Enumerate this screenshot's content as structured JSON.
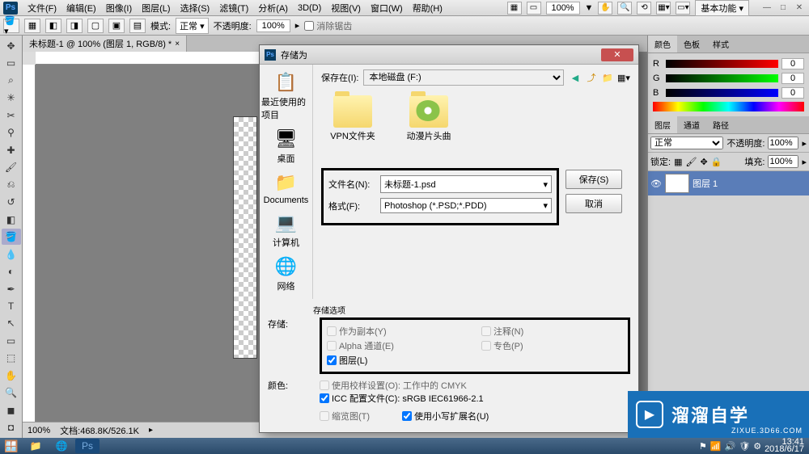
{
  "menubar": {
    "items": [
      "文件(F)",
      "编辑(E)",
      "图像(I)",
      "图层(L)",
      "选择(S)",
      "滤镜(T)",
      "分析(A)",
      "3D(D)",
      "视图(V)",
      "窗口(W)",
      "帮助(H)"
    ],
    "zoom": "100%",
    "workspace": "基本功能"
  },
  "optionsbar": {
    "mode_label": "模式:",
    "mode_value": "正常",
    "opacity_label": "不透明度:",
    "opacity_value": "100%",
    "antialias": "消除锯齿"
  },
  "document": {
    "tab": "未标题-1 @ 100% (图层 1, RGB/8) *",
    "zoom_status": "100%",
    "size_status": "文档:468.8K/526.1K"
  },
  "panels": {
    "color_tabs": [
      "颜色",
      "色板",
      "样式"
    ],
    "rgb": {
      "r": "0",
      "g": "0",
      "b": "0"
    },
    "layer_tabs": [
      "图层",
      "通道",
      "路径"
    ],
    "blend_mode": "正常",
    "opacity_label": "不透明度:",
    "opacity_value": "100%",
    "lock_label": "锁定:",
    "fill_label": "填充:",
    "fill_value": "100%",
    "layer_name": "图层 1"
  },
  "dialog": {
    "title": "存储为",
    "save_in_label": "保存在(I):",
    "save_in_value": "本地磁盘 (F:)",
    "places": [
      "最近使用的项目",
      "桌面",
      "Documents",
      "计算机",
      "网络"
    ],
    "files": [
      "VPN文件夹",
      "动漫片头曲"
    ],
    "filename_label": "文件名(N):",
    "filename_value": "未标题-1.psd",
    "format_label": "格式(F):",
    "format_value": "Photoshop (*.PSD;*.PDD)",
    "save_btn": "保存(S)",
    "cancel_btn": "取消",
    "storage_header": "存储选项",
    "storage_label": "存储:",
    "opt_copy": "作为副本(Y)",
    "opt_notes": "注释(N)",
    "opt_alpha": "Alpha 通道(E)",
    "opt_spot": "专色(P)",
    "opt_layers": "图层(L)",
    "color_label": "颜色:",
    "opt_proof": "使用校样设置(O): 工作中的 CMYK",
    "opt_icc": "ICC 配置文件(C): sRGB IEC61966-2.1",
    "opt_thumb": "缩览图(T)",
    "opt_lower": "使用小写扩展名(U)"
  },
  "watermark": {
    "text": "溜溜自学",
    "url": "ZIXUE.3D66.COM"
  },
  "taskbar": {
    "time": "13:41",
    "date": "2018/6/17"
  }
}
